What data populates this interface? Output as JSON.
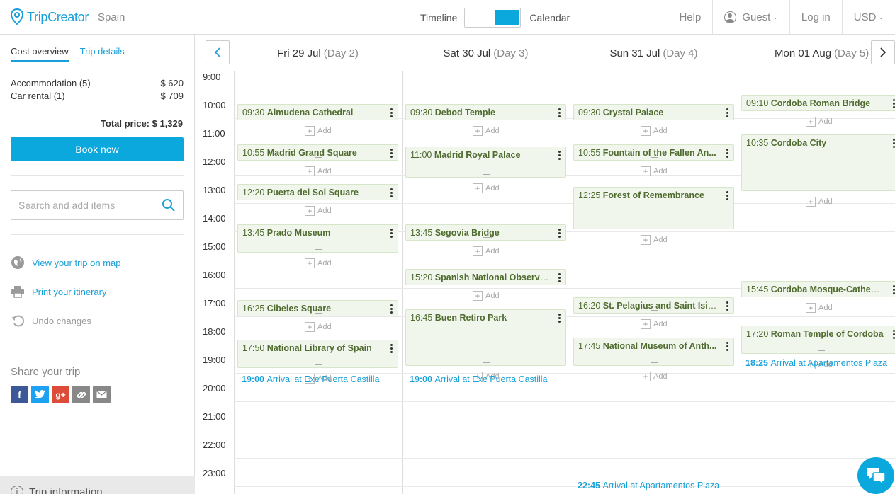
{
  "header": {
    "brand": "TripCreator",
    "destination": "Spain",
    "toggle_left": "Timeline",
    "toggle_right": "Calendar",
    "help": "Help",
    "user": "Guest",
    "login": "Log in",
    "currency": "USD"
  },
  "sidebar": {
    "tabs": [
      "Cost overview",
      "Trip details"
    ],
    "costs": [
      {
        "label": "Accommodation (5)",
        "amount": "$ 620"
      },
      {
        "label": "Car rental (1)",
        "amount": "$ 709"
      }
    ],
    "total": "Total price: $ 1,329",
    "book_label": "Book now",
    "search_placeholder": "Search and add items",
    "actions": [
      {
        "label": "View your trip on map",
        "icon": "globe-icon"
      },
      {
        "label": "Print your itinerary",
        "icon": "printer-icon"
      },
      {
        "label": "Undo changes",
        "icon": "undo-icon"
      }
    ],
    "share_title": "Share your trip",
    "share": [
      {
        "icon": "facebook-icon",
        "glyph": "f",
        "color": "#3b5998"
      },
      {
        "icon": "twitter-icon",
        "glyph": "t",
        "color": "#1da1f2"
      },
      {
        "icon": "google-plus-icon",
        "glyph": "g+",
        "color": "#dd4b39"
      },
      {
        "icon": "link-icon",
        "glyph": "∞",
        "color": "#888888"
      },
      {
        "icon": "email-icon",
        "glyph": "✉",
        "color": "#888888"
      }
    ],
    "trip_info": "Trip information"
  },
  "calendar": {
    "days": [
      {
        "date": "Fri 29 Jul",
        "day": "(Day 2)"
      },
      {
        "date": "Sat 30 Jul",
        "day": "(Day 3)"
      },
      {
        "date": "Sun 31 Jul",
        "day": "(Day 4)"
      },
      {
        "date": "Mon 01 Aug",
        "day": "(Day 5)"
      }
    ],
    "hours": [
      "9:00",
      "10:00",
      "11:00",
      "12:00",
      "13:00",
      "14:00",
      "15:00",
      "16:00",
      "17:00",
      "18:00",
      "19:00",
      "20:00",
      "21:00",
      "22:00",
      "23:00"
    ],
    "add_label": "Add",
    "events": [
      {
        "day": 0,
        "time": "09:30",
        "name": "Almudena Cathedral"
      },
      {
        "day": 0,
        "time": "10:55",
        "name": "Madrid Grand Square"
      },
      {
        "day": 0,
        "time": "12:20",
        "name": "Puerta del Sol Square"
      },
      {
        "day": 0,
        "time": "13:45",
        "name": "Prado Museum"
      },
      {
        "day": 0,
        "time": "16:25",
        "name": "Cibeles Square"
      },
      {
        "day": 0,
        "time": "17:50",
        "name": "National Library of Spain"
      },
      {
        "day": 1,
        "time": "09:30",
        "name": "Debod Temple"
      },
      {
        "day": 1,
        "time": "11:00",
        "name": "Madrid Royal Palace"
      },
      {
        "day": 1,
        "time": "13:45",
        "name": "Segovia Bridge"
      },
      {
        "day": 1,
        "time": "15:20",
        "name": "Spanish National Observa..."
      },
      {
        "day": 1,
        "time": "16:45",
        "name": "Buen Retiro Park"
      },
      {
        "day": 2,
        "time": "09:30",
        "name": "Crystal Palace"
      },
      {
        "day": 2,
        "time": "10:55",
        "name": "Fountain of the Fallen An..."
      },
      {
        "day": 2,
        "time": "12:25",
        "name": "Forest of Remembrance"
      },
      {
        "day": 2,
        "time": "16:20",
        "name": "St. Pelagius and Saint Isid..."
      },
      {
        "day": 2,
        "time": "17:45",
        "name": "National Museum of Anth..."
      },
      {
        "day": 3,
        "time": "09:10",
        "name": "Cordoba Roman Bridge"
      },
      {
        "day": 3,
        "time": "10:35",
        "name": "Cordoba City"
      },
      {
        "day": 3,
        "time": "15:45",
        "name": "Cordoba Mosque-Cathedr..."
      },
      {
        "day": 3,
        "time": "17:20",
        "name": "Roman Temple of Cordoba"
      }
    ],
    "arrivals": [
      {
        "day": 0,
        "time": "19:00",
        "text": "Arrival at Exe Puerta Castilla"
      },
      {
        "day": 1,
        "time": "19:00",
        "text": "Arrival at Exe Puerta Castilla"
      },
      {
        "day": 2,
        "time": "22:45",
        "text": "Arrival at Apartamentos Plaza"
      },
      {
        "day": 3,
        "time": "18:25",
        "text": "Arrival at Apartamentos Plaza"
      }
    ]
  },
  "colors": {
    "accent": "#0aa8dc",
    "event_bg": "#f1f6ec",
    "event_text": "#4f6b2f"
  }
}
